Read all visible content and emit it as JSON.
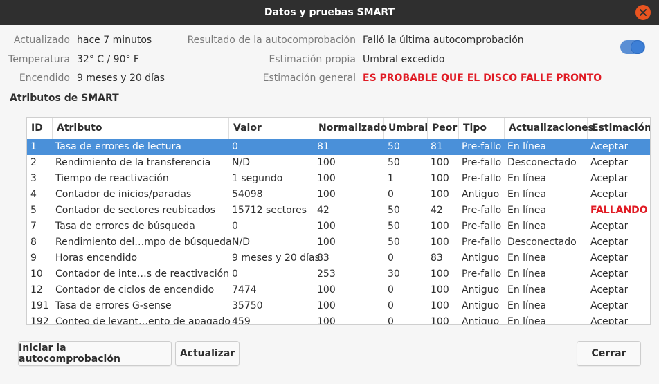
{
  "window": {
    "title": "Datos y pruebas SMART"
  },
  "info": {
    "updated_label": "Actualizado",
    "updated_value": "hace 7 minutos",
    "temperature_label": "Temperatura",
    "temperature_value": "32° C / 90° F",
    "power_on_label": "Encendido",
    "power_on_value": "9 meses y 20 días",
    "selftest_label": "Resultado de la autocomprobación",
    "selftest_value": "Falló la última autocomprobación",
    "self_assessment_label": "Estimación propia",
    "self_assessment_value": "Umbral excedido",
    "overall_label": "Estimación general",
    "overall_value": "ES PROBABLE QUE EL DISCO FALLE PRONTO",
    "toggle_on": true
  },
  "section_title": "Atributos de SMART",
  "table": {
    "headers": {
      "id": "ID",
      "attribute": "Atributo",
      "value": "Valor",
      "normalized": "Normalizado",
      "threshold": "Umbral",
      "worst": "Peor",
      "type": "Tipo",
      "updates": "Actualizaciones",
      "assessment": "Estimación"
    },
    "rows": [
      {
        "id": "1",
        "attribute": "Tasa de errores de lectura",
        "value": "0",
        "normalized": "81",
        "threshold": "50",
        "worst": "81",
        "type": "Pre-fallo",
        "updates": "En línea",
        "assessment": "Aceptar",
        "selected": true,
        "failing": false
      },
      {
        "id": "2",
        "attribute": "Rendimiento de la transferencia",
        "value": "N/D",
        "normalized": "100",
        "threshold": "50",
        "worst": "100",
        "type": "Pre-fallo",
        "updates": "Desconectado",
        "assessment": "Aceptar",
        "selected": false,
        "failing": false
      },
      {
        "id": "3",
        "attribute": "Tiempo de reactivación",
        "value": "1 segundo",
        "normalized": "100",
        "threshold": "1",
        "worst": "100",
        "type": "Pre-fallo",
        "updates": "En línea",
        "assessment": "Aceptar",
        "selected": false,
        "failing": false
      },
      {
        "id": "4",
        "attribute": "Contador de inicios/paradas",
        "value": "54098",
        "normalized": "100",
        "threshold": "0",
        "worst": "100",
        "type": "Antiguo",
        "updates": "En línea",
        "assessment": "Aceptar",
        "selected": false,
        "failing": false
      },
      {
        "id": "5",
        "attribute": "Contador de sectores reubicados",
        "value": "15712 sectores",
        "normalized": "42",
        "threshold": "50",
        "worst": "42",
        "type": "Pre-fallo",
        "updates": "En línea",
        "assessment": "FALLANDO",
        "selected": false,
        "failing": true
      },
      {
        "id": "7",
        "attribute": "Tasa de errores de búsqueda",
        "value": "0",
        "normalized": "100",
        "threshold": "50",
        "worst": "100",
        "type": "Pre-fallo",
        "updates": "En línea",
        "assessment": "Aceptar",
        "selected": false,
        "failing": false
      },
      {
        "id": "8",
        "attribute": "Rendimiento del…mpo de búsqueda",
        "value": "N/D",
        "normalized": "100",
        "threshold": "50",
        "worst": "100",
        "type": "Pre-fallo",
        "updates": "Desconectado",
        "assessment": "Aceptar",
        "selected": false,
        "failing": false
      },
      {
        "id": "9",
        "attribute": "Horas encendido",
        "value": "9 meses y 20 días",
        "normalized": "83",
        "threshold": "0",
        "worst": "83",
        "type": "Antiguo",
        "updates": "En línea",
        "assessment": "Aceptar",
        "selected": false,
        "failing": false
      },
      {
        "id": "10",
        "attribute": "Contador de inte…s de reactivación",
        "value": "0",
        "normalized": "253",
        "threshold": "30",
        "worst": "100",
        "type": "Pre-fallo",
        "updates": "En línea",
        "assessment": "Aceptar",
        "selected": false,
        "failing": false
      },
      {
        "id": "12",
        "attribute": "Contador de ciclos de encendido",
        "value": "7474",
        "normalized": "100",
        "threshold": "0",
        "worst": "100",
        "type": "Antiguo",
        "updates": "En línea",
        "assessment": "Aceptar",
        "selected": false,
        "failing": false
      },
      {
        "id": "191",
        "attribute": "Tasa de errores G-sense",
        "value": "35750",
        "normalized": "100",
        "threshold": "0",
        "worst": "100",
        "type": "Antiguo",
        "updates": "En línea",
        "assessment": "Aceptar",
        "selected": false,
        "failing": false
      },
      {
        "id": "192",
        "attribute": "Conteo de levant…ento de apagado",
        "value": "459",
        "normalized": "100",
        "threshold": "0",
        "worst": "100",
        "type": "Antiguo",
        "updates": "En línea",
        "assessment": "Aceptar",
        "selected": false,
        "failing": false
      }
    ]
  },
  "buttons": {
    "start_selftest": "Iniciar la autocomprobación",
    "refresh": "Actualizar",
    "close": "Cerrar"
  },
  "colors": {
    "accent": "#4a90d9",
    "danger": "#e01b24",
    "titlebar": "#2f2f2f",
    "close_button": "#e95420"
  },
  "icons": {
    "close": "close-icon"
  }
}
